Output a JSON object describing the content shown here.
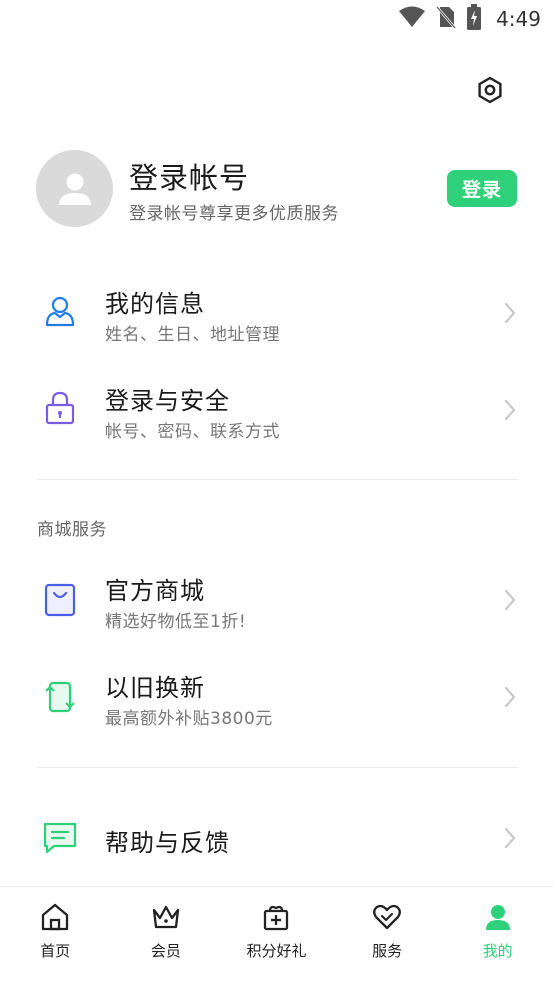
{
  "status_bar": {
    "time": "4:49"
  },
  "profile": {
    "title": "登录帐号",
    "subtitle": "登录帐号尊享更多优质服务",
    "login_label": "登录"
  },
  "account_items": [
    {
      "title": "我的信息",
      "subtitle": "姓名、生日、地址管理",
      "icon": "person-icon"
    },
    {
      "title": "登录与安全",
      "subtitle": "帐号、密码、联系方式",
      "icon": "lock-icon"
    }
  ],
  "mall": {
    "section_label": "商城服务",
    "items": [
      {
        "title": "官方商城",
        "subtitle": "精选好物低至1折!",
        "icon": "shopping-bag-icon"
      },
      {
        "title": "以旧换新",
        "subtitle": "最高额外补贴3800元",
        "icon": "trade-in-icon"
      }
    ]
  },
  "help": {
    "title": "帮助与反馈",
    "icon": "chat-icon"
  },
  "tabs": [
    {
      "label": "首页",
      "icon": "home-icon"
    },
    {
      "label": "会员",
      "icon": "crown-icon"
    },
    {
      "label": "积分好礼",
      "icon": "gift-icon"
    },
    {
      "label": "服务",
      "icon": "heart-icon"
    },
    {
      "label": "我的",
      "icon": "user-icon",
      "active": true
    }
  ],
  "colors": {
    "accent": "#2fd07a",
    "person_icon": "#1e7ee6",
    "lock_icon": "#7a5ce0",
    "bag_icon": "#4a5fe8",
    "tradein_icon": "#2fd07a",
    "chat_icon": "#2fd07a"
  }
}
